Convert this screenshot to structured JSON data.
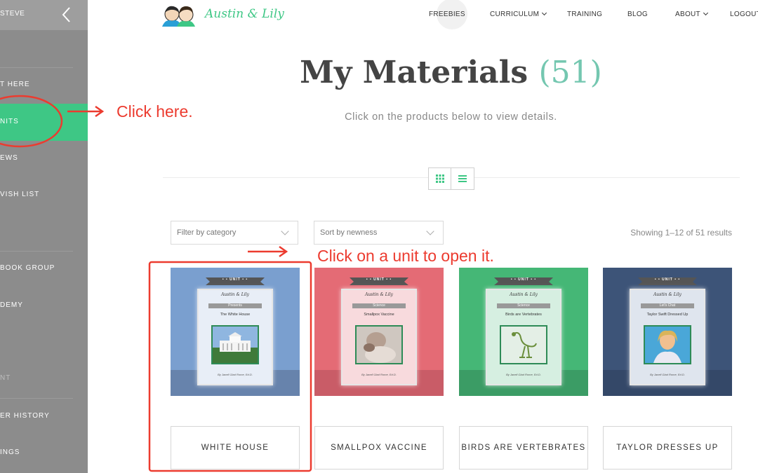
{
  "sidebar": {
    "user": "STEVE",
    "items": [
      {
        "label": "T HERE",
        "name": "sidebar-item-start-here"
      },
      {
        "label": "NITS",
        "name": "sidebar-item-units"
      },
      {
        "label": "EWS",
        "name": "sidebar-item-reviews"
      },
      {
        "label": "VISH LIST",
        "name": "sidebar-item-wish-list"
      },
      {
        "label": "BOOK GROUP",
        "name": "sidebar-item-facebook-group"
      },
      {
        "label": "DEMY",
        "name": "sidebar-item-academy"
      },
      {
        "label": "NT",
        "name": "sidebar-item-account"
      },
      {
        "label": "ER HISTORY",
        "name": "sidebar-item-order-history"
      },
      {
        "label": "INGS",
        "name": "sidebar-item-settings"
      }
    ]
  },
  "header": {
    "logo_text": "Austin & Lily",
    "nav": [
      {
        "label": "FREEBIES",
        "dropdown": false
      },
      {
        "label": "CURRICULUM",
        "dropdown": true
      },
      {
        "label": "TRAINING",
        "dropdown": false
      },
      {
        "label": "BLOG",
        "dropdown": false
      },
      {
        "label": "ABOUT",
        "dropdown": true
      },
      {
        "label": "LOGOUT",
        "dropdown": false
      }
    ]
  },
  "page": {
    "title": "My Materials",
    "count": "(51)",
    "subtitle": "Click on the products below to view details."
  },
  "filters": {
    "category": "Filter by category",
    "sort": "Sort by newness",
    "results": "Showing 1–12 of 51 results"
  },
  "annotations": {
    "click_here": "Click here.",
    "click_unit": "Click on a unit to open it."
  },
  "products": [
    {
      "label": "WHITE HOUSE",
      "category": "Presents",
      "cover_title": "The White House",
      "byline": "By Janell Glad Rome, Ed.D.",
      "bg": "#7a9fcf",
      "band": "#6783ac",
      "page": "#e8eef7",
      "pic": "white-house"
    },
    {
      "label": "SMALLPOX VACCINE",
      "category": "Science",
      "cover_title": "Smallpox Vaccine",
      "byline": "By Janell Glad Rome, Ed.D.",
      "bg": "#e46b75",
      "band": "#c95c67",
      "page": "#f8dadd",
      "pic": "vaccine"
    },
    {
      "label": "BIRDS ARE VERTEBRATES",
      "category": "Science",
      "cover_title": "Birds are Vertebrates",
      "byline": "By Janell Glad Rome, Ed.D.",
      "bg": "#45b776",
      "band": "#3b9c65",
      "page": "#d6efe1",
      "pic": "bird-skeleton"
    },
    {
      "label": "TAYLOR DRESSES UP",
      "category": "Let's Chat",
      "cover_title": "Taylor Swift Dressed Up",
      "byline": "By Janell Glad Rome, Ed.D.",
      "bg": "#3d5478",
      "band": "#344868",
      "page": "#dfe5ee",
      "pic": "taylor"
    }
  ],
  "banner_label": "• • UNIT • •",
  "cover_logo": "Austin & Lily",
  "colors": {
    "accent": "#3ec785",
    "annotation": "#ec3b2f",
    "title_count": "#74c7b0"
  }
}
